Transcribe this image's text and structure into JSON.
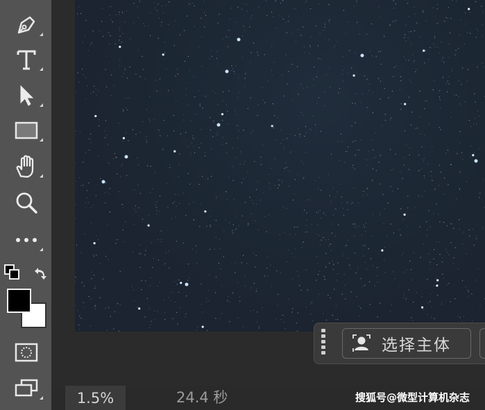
{
  "toolbar": {
    "tools": [
      {
        "name": "pen-tool",
        "icon": "pen-icon"
      },
      {
        "name": "type-tool",
        "icon": "type-icon"
      },
      {
        "name": "selection-tool",
        "icon": "arrow-icon"
      },
      {
        "name": "rectangle-tool",
        "icon": "rectangle-icon"
      },
      {
        "name": "hand-tool",
        "icon": "hand-icon"
      },
      {
        "name": "zoom-tool",
        "icon": "magnifier-icon"
      },
      {
        "name": "more-tools",
        "icon": "ellipsis-icon"
      }
    ],
    "foreground_color": "#000000",
    "background_color": "#ffffff"
  },
  "taskbar": {
    "select_subject_label": "选择主体"
  },
  "status": {
    "zoom": "1.5%",
    "timing": "24.4 秒",
    "watermark": "搜狐号@微型计算机杂志"
  }
}
